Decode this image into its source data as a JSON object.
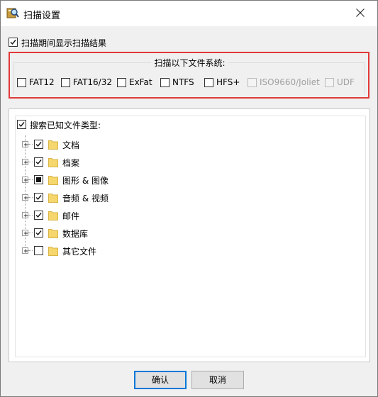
{
  "window": {
    "title": "扫描设置",
    "icons": {
      "app": "magnifier-app-icon",
      "close": "close-icon"
    }
  },
  "show_results": {
    "label": "扫描期间显示扫描结果",
    "checked": true
  },
  "filesystems": {
    "title": "扫描以下文件系统:",
    "items": [
      {
        "label": "FAT12",
        "checked": false,
        "enabled": true
      },
      {
        "label": "FAT16/32",
        "checked": false,
        "enabled": true
      },
      {
        "label": "ExFat",
        "checked": false,
        "enabled": true
      },
      {
        "label": "NTFS",
        "checked": false,
        "enabled": true
      },
      {
        "label": "HFS+",
        "checked": false,
        "enabled": true
      },
      {
        "label": "ISO9660/Joliet",
        "checked": false,
        "enabled": false
      },
      {
        "label": "UDF",
        "checked": false,
        "enabled": false
      }
    ]
  },
  "filetypes": {
    "root_label": "搜索已知文件类型:",
    "root_checked": true,
    "items": [
      {
        "label": "文档",
        "state": "checked"
      },
      {
        "label": "档案",
        "state": "checked"
      },
      {
        "label": "图形 & 图像",
        "state": "partial"
      },
      {
        "label": "音频 & 视频",
        "state": "checked"
      },
      {
        "label": "邮件",
        "state": "checked"
      },
      {
        "label": "数据库",
        "state": "checked"
      },
      {
        "label": "其它文件",
        "state": "unchecked"
      }
    ]
  },
  "buttons": {
    "ok": "确认",
    "cancel": "取消"
  },
  "colors": {
    "highlight": "#e03a3a",
    "folder": "#f5d76e",
    "default_button_border": "#0078d7"
  }
}
